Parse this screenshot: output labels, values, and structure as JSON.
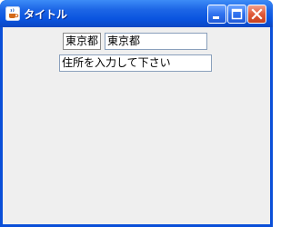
{
  "window": {
    "title": "タイトル",
    "app_icon": "java-cup-icon",
    "buttons": {
      "minimize": "minimize-icon",
      "maximize": "maximize-icon",
      "close": "close-icon"
    },
    "colors": {
      "titlebar": "#1d66e6",
      "client": "#efefef",
      "close": "#e0593a"
    }
  },
  "form": {
    "prefecture_label": "東京都",
    "prefecture_value": "東京都",
    "address_value": "住所を入力して下さい"
  }
}
